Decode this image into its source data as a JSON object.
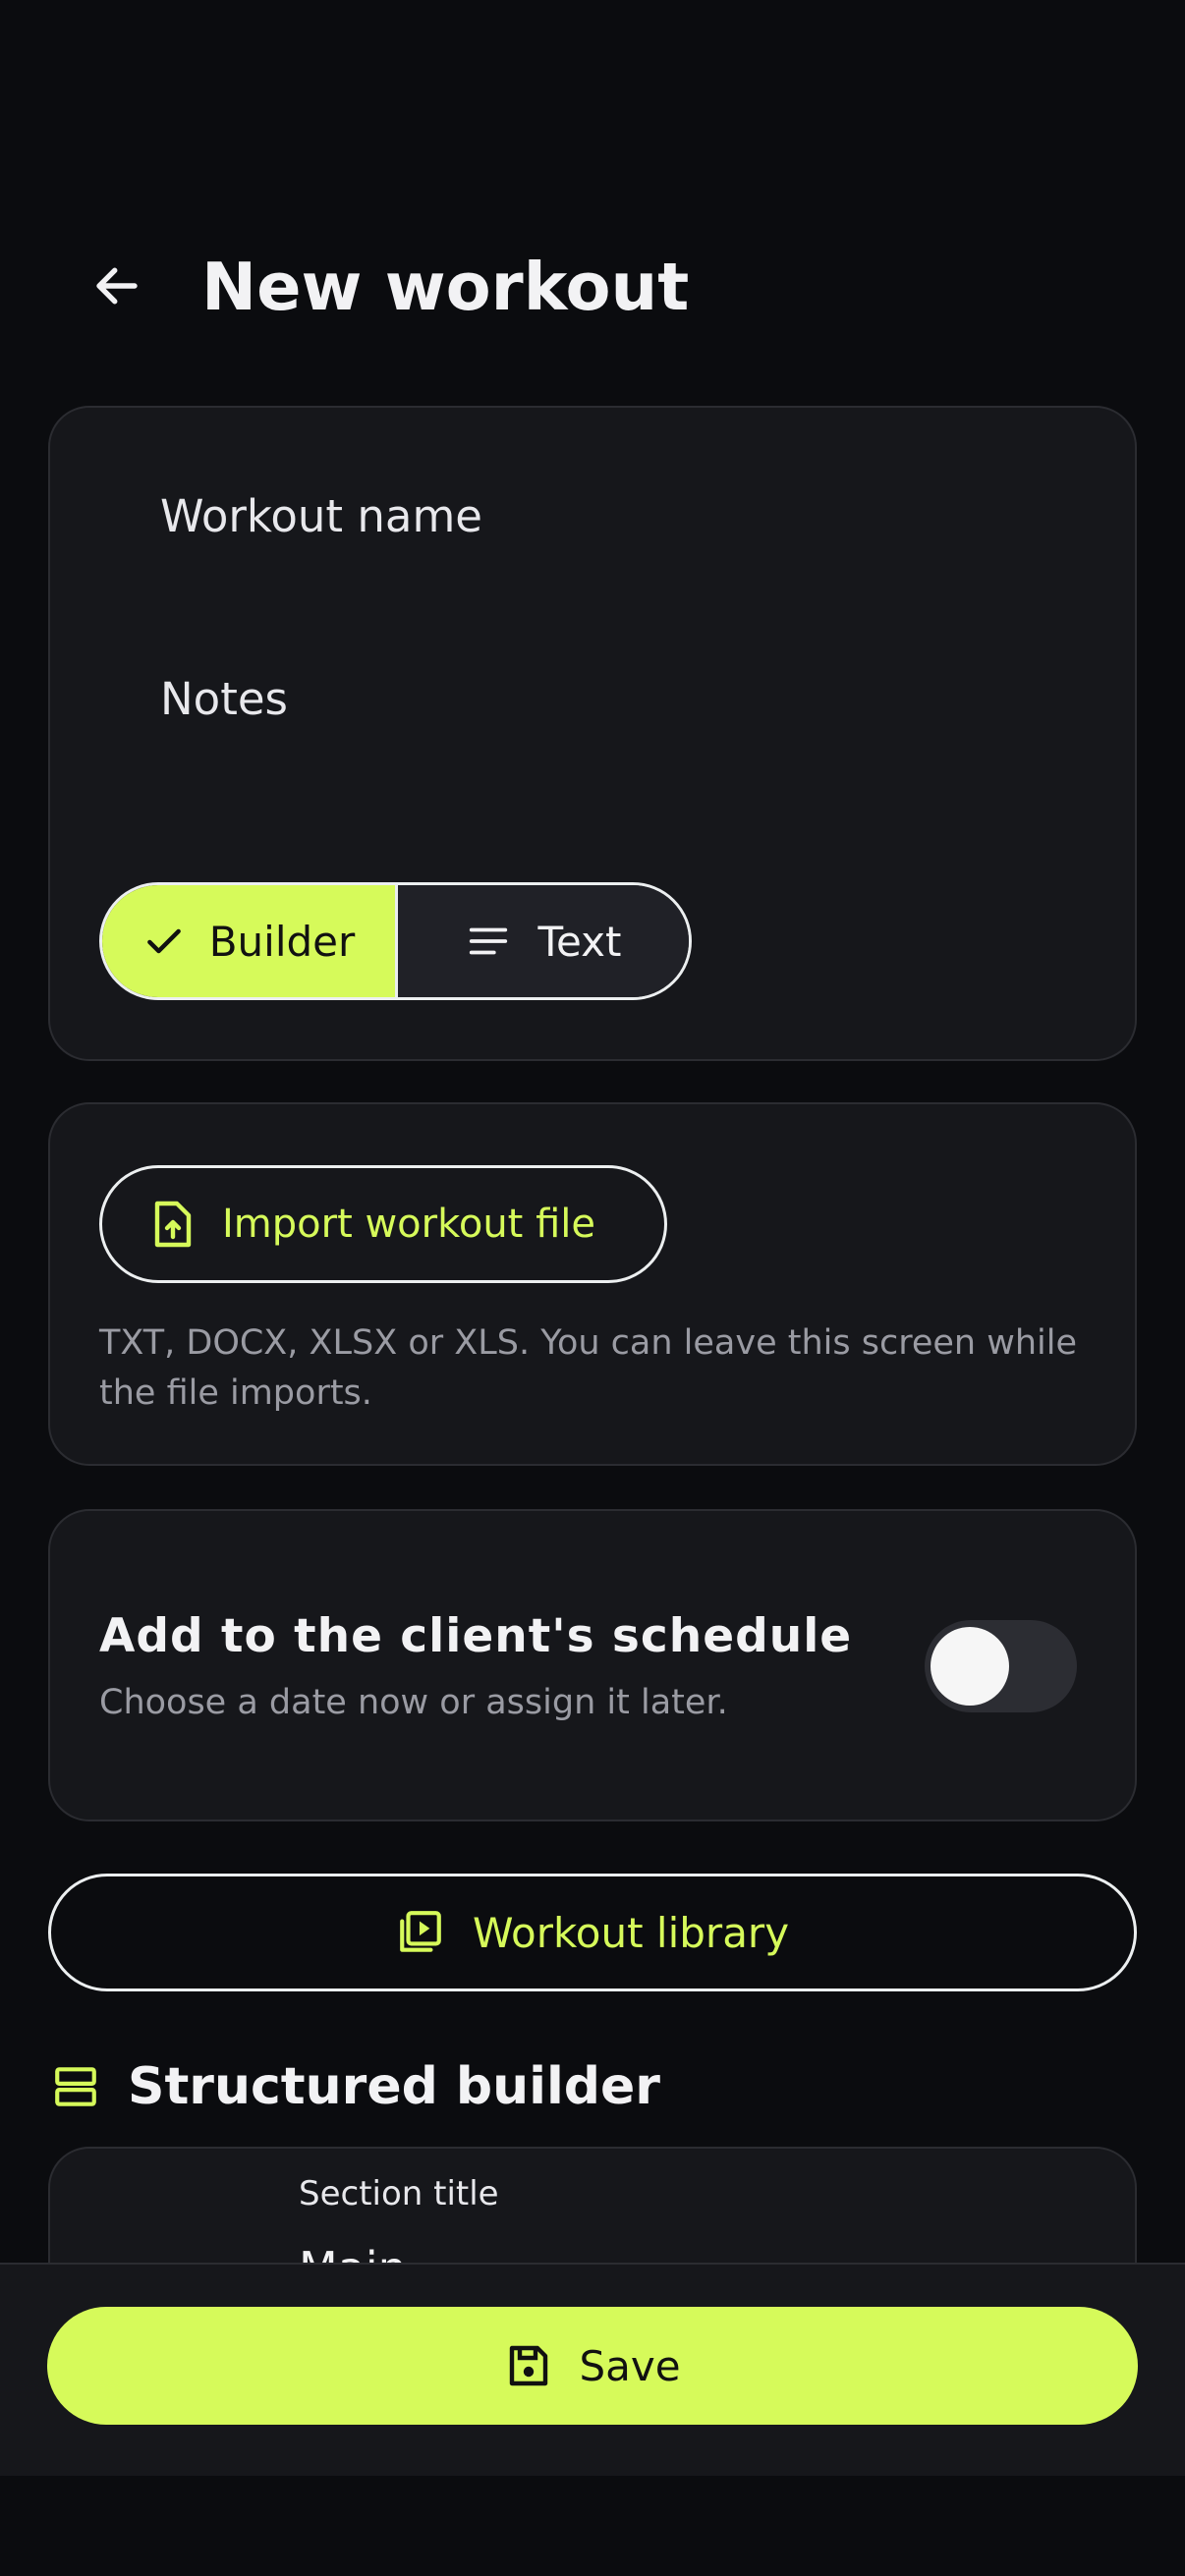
{
  "header": {
    "title": "New workout"
  },
  "form": {
    "name_placeholder": "Workout name",
    "notes_placeholder": "Notes",
    "mode_toggle": {
      "builder_label": "Builder",
      "text_label": "Text",
      "selected": "Builder"
    }
  },
  "import": {
    "button_label": "Import workout file",
    "hint": "TXT, DOCX, XLSX or XLS. You can leave this screen while the file imports."
  },
  "schedule": {
    "title": "Add to the client's schedule",
    "subtitle": "Choose a date now or assign it later.",
    "enabled": false
  },
  "library": {
    "button_label": "Workout library"
  },
  "builder": {
    "heading": "Structured builder",
    "section_title_label": "Section title",
    "section_title_value": "Main"
  },
  "footer": {
    "save_label": "Save"
  },
  "colors": {
    "accent": "#d6fa5a",
    "background": "#0b0c0f",
    "card": "#16171b"
  }
}
